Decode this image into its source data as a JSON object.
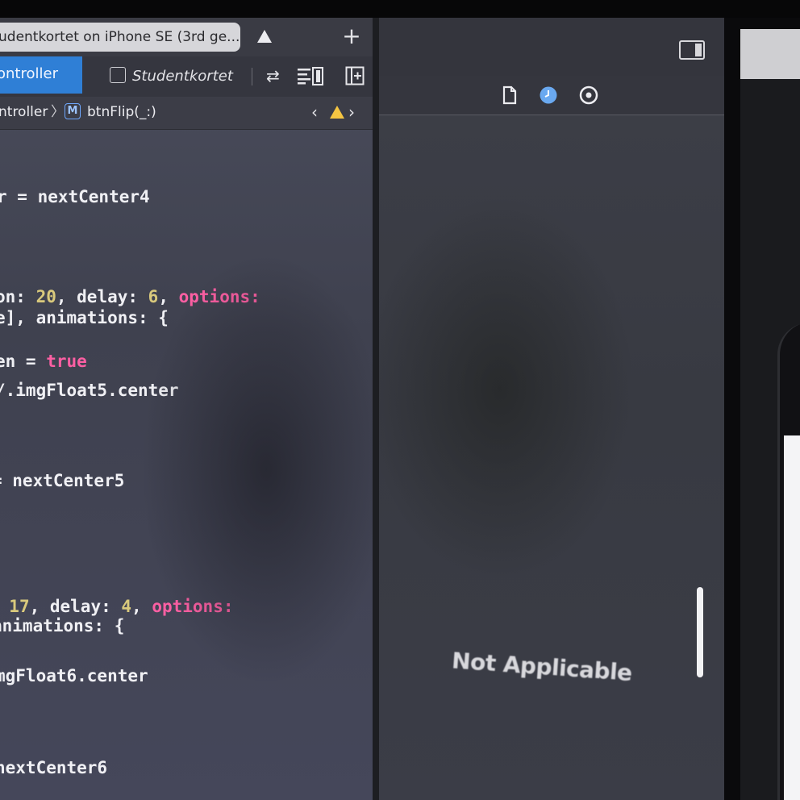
{
  "window": {
    "run_destination_tab": "udentkortet on iPhone SE (3rd ge...",
    "add_tab_glyph": "+"
  },
  "toolbar": {
    "controller_tab": "ontroller",
    "storyboard_tab": "Studentkortet"
  },
  "jumpbar": {
    "controller_crumb": "ntroller",
    "method_badge": "M",
    "method_name": "btnFlip(_:)"
  },
  "code_lines": [
    {
      "pre": "r = nextCenter4"
    },
    {
      "pre": "on: ",
      "num1": "20",
      "mid": ", delay: ",
      "num2": "6",
      "post": ", ",
      "kw": "options:"
    },
    {
      "pre": "e], animations: {"
    },
    {
      "pre": "en = ",
      "kw": "true"
    },
    {
      "pre": "/.imgFloat5.center"
    },
    {
      "pre": "= nextCenter5"
    },
    {
      "pre": ": ",
      "num1": "17",
      "mid": ", delay: ",
      "num2": "4",
      "post": ", ",
      "kw": "options:"
    },
    {
      "pre": " animations: {"
    },
    {
      "pre": "mgFloat6.center"
    },
    {
      "pre": "nextCenter6"
    }
  ],
  "canvas": {
    "status_text": "Not Applicable"
  },
  "colors": {
    "accent_blue": "#2f7fd6",
    "warning_yellow": "#f5c542",
    "keyword_pink": "#fc5fa3",
    "number_yellow": "#d9c97c"
  },
  "icons": {
    "warning": "warning-triangle-icon",
    "add": "plus-icon",
    "swap": "swap-arrows-icon",
    "minimap": "minimap-icon",
    "add_editor": "add-editor-icon",
    "file": "file-icon",
    "history": "history-icon",
    "help": "help-icon",
    "inspector": "inspector-toggle-icon"
  }
}
